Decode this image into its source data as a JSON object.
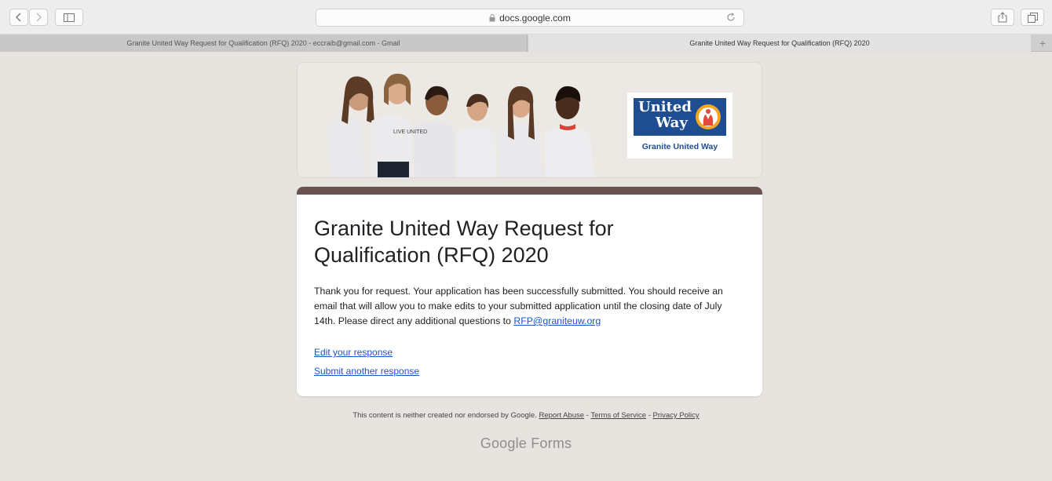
{
  "browser": {
    "url": "docs.google.com",
    "tabs": [
      {
        "label": "Granite United Way Request for Qualification (RFQ) 2020 - eccraib@gmail.com - Gmail"
      },
      {
        "label": "Granite United Way Request for Qualification (RFQ) 2020"
      }
    ],
    "new_tab_label": "+"
  },
  "header": {
    "logo": {
      "line1": "United",
      "line2": "Way",
      "caption": "Granite United Way"
    },
    "shirt_text": "LIVE UNITED"
  },
  "form": {
    "title": "Granite United Way Request for Qualification (RFQ) 2020",
    "message_before_link": "Thank you for request. Your application has been successfully submitted. You should receive an email that will allow you to make edits to your submitted application until the closing date of July 14th. Please direct any additional questions to ",
    "email_link": "RFP@graniteuw.org",
    "edit_link": "Edit your response",
    "submit_another_link": "Submit another response",
    "accent_color": "#6a5250"
  },
  "footer": {
    "disclaimer": "This content is neither created nor endorsed by Google.",
    "report_abuse": "Report Abuse",
    "sep1": " - ",
    "terms": "Terms of Service",
    "sep2": " - ",
    "privacy": "Privacy Policy",
    "brand_google": "Google",
    "brand_forms": " Forms"
  }
}
